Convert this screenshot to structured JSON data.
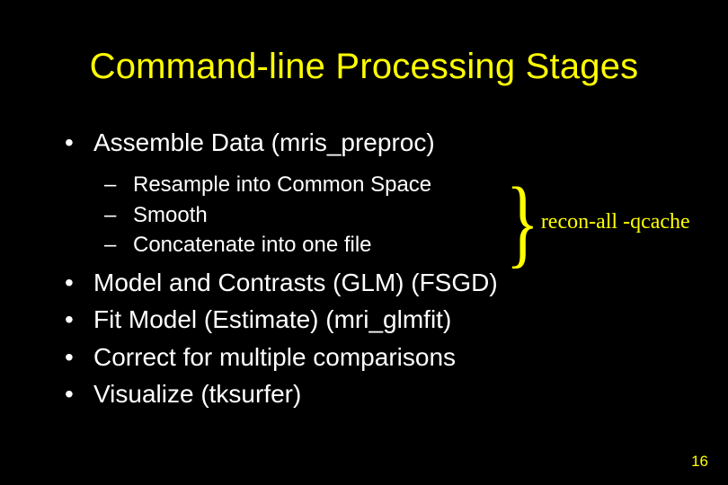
{
  "title": "Command-line Processing Stages",
  "bullets": {
    "b0": "Assemble Data (mris_preproc)",
    "sub": {
      "s0": "Resample into Common Space",
      "s1": "Smooth",
      "s2": "Concatenate into one file"
    },
    "b1": "Model and Contrasts (GLM) (FSGD)",
    "b2": "Fit Model (Estimate) (mri_glmfit)",
    "b3": "Correct for multiple comparisons",
    "b4": "Visualize (tksurfer)"
  },
  "brace": {
    "symbol": "}",
    "label": "recon-all -qcache"
  },
  "page_number": "16",
  "colors": {
    "background": "#000000",
    "title": "#ffff00",
    "body": "#ffffff",
    "accent": "#ffff00"
  }
}
